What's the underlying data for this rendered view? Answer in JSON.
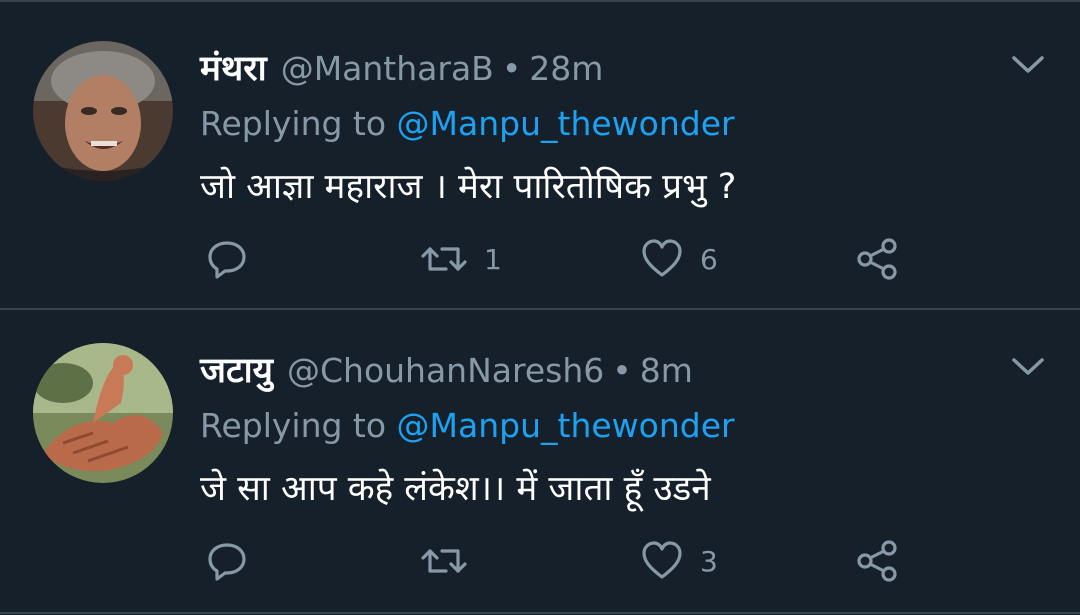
{
  "tweets": [
    {
      "display_name": "मंथरा",
      "handle": "@MantharaB",
      "separator": "•",
      "time": "28m",
      "reply_prefix": "Replying to",
      "reply_mention": "@Manpu_thewonder",
      "text": "जो आज्ञा महाराज । मेरा पारितोषिक प्रभु ?",
      "reply_count": "",
      "retweet_count": "1",
      "like_count": "6",
      "icons": [
        "reply-icon",
        "retweet-icon",
        "like-icon",
        "share-icon",
        "chevron-down-icon"
      ]
    },
    {
      "display_name": "जटायु",
      "handle": "@ChouhanNaresh6",
      "separator": "•",
      "time": "8m",
      "reply_prefix": "Replying to",
      "reply_mention": "@Manpu_thewonder",
      "text": "जे सा आप कहे लंकेश।।  में जाता हूँ उडने",
      "reply_count": "",
      "retweet_count": "",
      "like_count": "3",
      "icons": [
        "reply-icon",
        "retweet-icon",
        "like-icon",
        "share-icon",
        "chevron-down-icon"
      ]
    }
  ],
  "colors": {
    "background": "#15202b",
    "divider": "#38444d",
    "primary_text": "#ffffff",
    "secondary_text": "#8899a6",
    "link": "#1da1f2"
  }
}
